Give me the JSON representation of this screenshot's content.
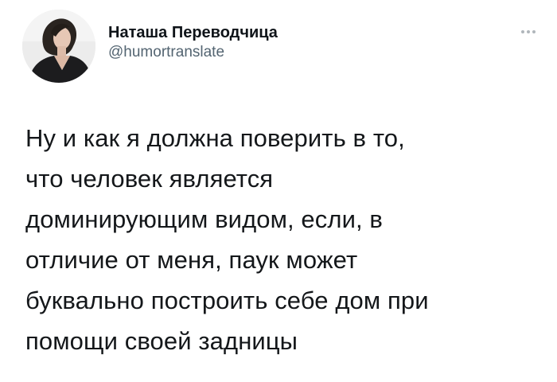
{
  "tweet": {
    "author": {
      "display_name": "Наташа Переводчица",
      "handle": "@humortranslate",
      "avatar_icon": "profile-photo"
    },
    "more_icon": "more-options-icon",
    "text_lines": [
      "Ну и как я должна поверить в то,",
      "что человек является",
      "доминирующим видом, если, в",
      "отличие от меня, паук может",
      "буквально построить себе дом при",
      "помощи своей задницы"
    ]
  },
  "colors": {
    "background": "#ffffff",
    "text": "#14171a",
    "secondary_text": "#536471"
  }
}
